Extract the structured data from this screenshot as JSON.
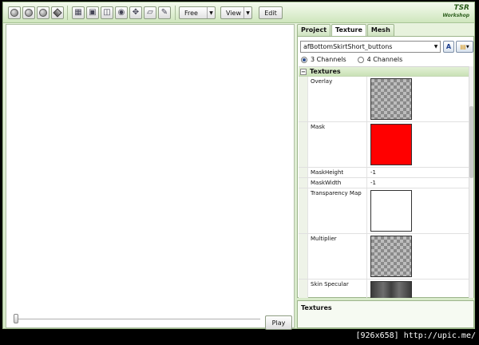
{
  "toolbar": {
    "mode_dropdown": "Free",
    "view_dropdown": "View",
    "edit_button": "Edit",
    "logo_line1": "TSR",
    "logo_line2": "Workshop"
  },
  "viewport": {
    "play_button": "Play"
  },
  "panel": {
    "tabs": [
      {
        "label": "Project"
      },
      {
        "label": "Texture"
      },
      {
        "label": "Mesh"
      }
    ],
    "active_tab": "Texture",
    "preset_value": "afBottomSkirtShort_buttons",
    "a_button": "A",
    "channel_options": [
      "3 Channels",
      "4 Channels"
    ],
    "selected_channel": "3 Channels",
    "section_title": "Textures",
    "properties": [
      {
        "name": "Overlay",
        "kind": "image",
        "preview": "checker-overlay"
      },
      {
        "name": "Mask",
        "kind": "image",
        "preview": "solid",
        "color": "#ff0000"
      },
      {
        "name": "MaskHeight",
        "kind": "text",
        "value": "-1"
      },
      {
        "name": "MaskWidth",
        "kind": "text",
        "value": "-1"
      },
      {
        "name": "Transparency Map",
        "kind": "image",
        "preview": "solid",
        "color": "#ffffff"
      },
      {
        "name": "Multiplier",
        "kind": "image",
        "preview": "checker-multiplier"
      },
      {
        "name": "Skin Specular",
        "kind": "image",
        "preview": "gray-specular"
      }
    ],
    "description_title": "Textures"
  },
  "watermark": "[926x658] http://upic.me/"
}
